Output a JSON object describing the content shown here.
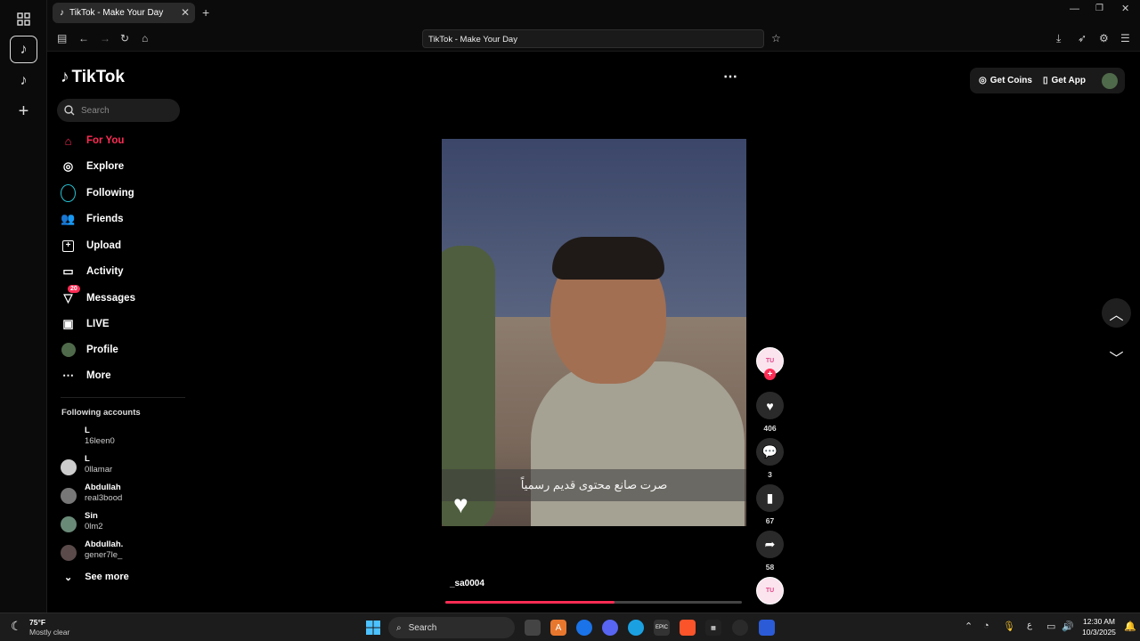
{
  "browser": {
    "tab_title": "TikTok - Make Your Day",
    "url_text": "TikTok - Make Your Day"
  },
  "tiktok": {
    "logo": "TikTok",
    "search_placeholder": "Search",
    "nav": [
      {
        "label": "For You",
        "icon": "home-icon",
        "active": true
      },
      {
        "label": "Explore",
        "icon": "compass-icon"
      },
      {
        "label": "Following",
        "icon": "following-icon"
      },
      {
        "label": "Friends",
        "icon": "friends-icon"
      },
      {
        "label": "Upload",
        "icon": "upload-icon"
      },
      {
        "label": "Activity",
        "icon": "activity-icon"
      },
      {
        "label": "Messages",
        "icon": "messages-icon",
        "badge": "20"
      },
      {
        "label": "LIVE",
        "icon": "live-icon"
      },
      {
        "label": "Profile",
        "icon": "profile-icon"
      },
      {
        "label": "More",
        "icon": "more-icon"
      }
    ],
    "following_title": "Following accounts",
    "accounts": [
      {
        "name": "L",
        "handle": "16leen0"
      },
      {
        "name": "L",
        "handle": "0llamar"
      },
      {
        "name": "Abdullah",
        "handle": "real3bood"
      },
      {
        "name": "Sin",
        "handle": "0lm2"
      },
      {
        "name": "Abdullah.",
        "handle": "gener7le_"
      }
    ],
    "see_more": "See more",
    "get_coins": "Get Coins",
    "get_app": "Get App"
  },
  "video": {
    "caption": "صرت صانع محتوى قديم رسمياً",
    "username": "_sa0004",
    "likes": "406",
    "comments": "3",
    "saves": "67",
    "shares": "58",
    "progress": 0.57,
    "creator_badge": "TU"
  },
  "taskbar": {
    "weather_temp": "75°F",
    "weather_desc": "Mostly clear",
    "search_label": "Search",
    "time": "12:30 AM",
    "date": "10/3/2025",
    "lang": "ع"
  },
  "colors": {
    "accent": "#fe2c55"
  }
}
